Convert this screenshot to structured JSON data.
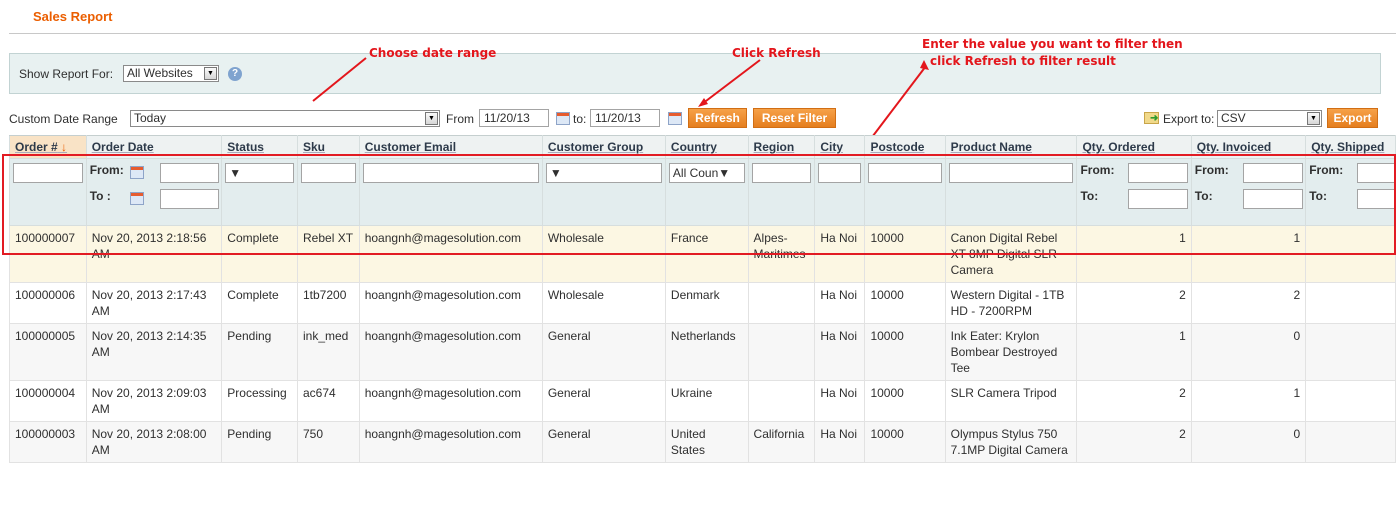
{
  "page": {
    "title": "Sales Report"
  },
  "store": {
    "label": "Show Report For:",
    "value": "All Websites",
    "help": "?"
  },
  "dates": {
    "range_label": "Custom Date Range",
    "range_value": "Today",
    "from_label": "From",
    "from_value": "11/20/13",
    "to_label": "to:",
    "to_value": "11/20/13"
  },
  "actions": {
    "refresh": "Refresh",
    "reset": "Reset Filter",
    "export_label": "Export to:",
    "export_format": "CSV",
    "export": "Export"
  },
  "annotations": {
    "date": "Choose date range",
    "refresh": "Click Refresh",
    "filter_line1": "Enter the value you want to filter then",
    "filter_line2": "click Refresh to filter result"
  },
  "filters": {
    "from": "From:",
    "to": "To:",
    "to_colon": "To :",
    "country_default": "All Coun"
  },
  "columns": [
    "Order #",
    "Order Date",
    "Status",
    "Sku",
    "Customer Email",
    "Customer Group",
    "Country",
    "Region",
    "City",
    "Postcode",
    "Product Name",
    "Qty. Ordered",
    "Qty. Invoiced",
    "Qty. Shipped"
  ],
  "rows": [
    {
      "order": "100000007",
      "date": "Nov 20, 2013 2:18:56 AM",
      "status": "Complete",
      "sku": "Rebel XT",
      "email": "hoangnh@magesolution.com",
      "group": "Wholesale",
      "country": "France",
      "region": "Alpes-Maritimes",
      "city": "Ha Noi",
      "postcode": "10000",
      "product": "Canon Digital Rebel XT 8MP Digital SLR Camera",
      "ordered": "1",
      "invoiced": "1",
      "shipped": ""
    },
    {
      "order": "100000006",
      "date": "Nov 20, 2013 2:17:43 AM",
      "status": "Complete",
      "sku": "1tb7200",
      "email": "hoangnh@magesolution.com",
      "group": "Wholesale",
      "country": "Denmark",
      "region": "",
      "city": "Ha Noi",
      "postcode": "10000",
      "product": "Western Digital - 1TB HD - 7200RPM",
      "ordered": "2",
      "invoiced": "2",
      "shipped": ""
    },
    {
      "order": "100000005",
      "date": "Nov 20, 2013 2:14:35 AM",
      "status": "Pending",
      "sku": "ink_med",
      "email": "hoangnh@magesolution.com",
      "group": "General",
      "country": "Netherlands",
      "region": "",
      "city": "Ha Noi",
      "postcode": "10000",
      "product": "Ink Eater: Krylon Bombear Destroyed Tee",
      "ordered": "1",
      "invoiced": "0",
      "shipped": ""
    },
    {
      "order": "100000004",
      "date": "Nov 20, 2013 2:09:03 AM",
      "status": "Processing",
      "sku": "ac674",
      "email": "hoangnh@magesolution.com",
      "group": "General",
      "country": "Ukraine",
      "region": "",
      "city": "Ha Noi",
      "postcode": "10000",
      "product": "SLR Camera Tripod",
      "ordered": "2",
      "invoiced": "1",
      "shipped": ""
    },
    {
      "order": "100000003",
      "date": "Nov 20, 2013 2:08:00 AM",
      "status": "Pending",
      "sku": "750",
      "email": "hoangnh@magesolution.com",
      "group": "General",
      "country": "United States",
      "region": "California",
      "city": "Ha Noi",
      "postcode": "10000",
      "product": "Olympus Stylus 750 7.1MP Digital Camera",
      "ordered": "2",
      "invoiced": "0",
      "shipped": ""
    }
  ],
  "colors": {
    "accent": "#eb5e00",
    "button": "#f09232",
    "annotation": "#e3161c"
  }
}
